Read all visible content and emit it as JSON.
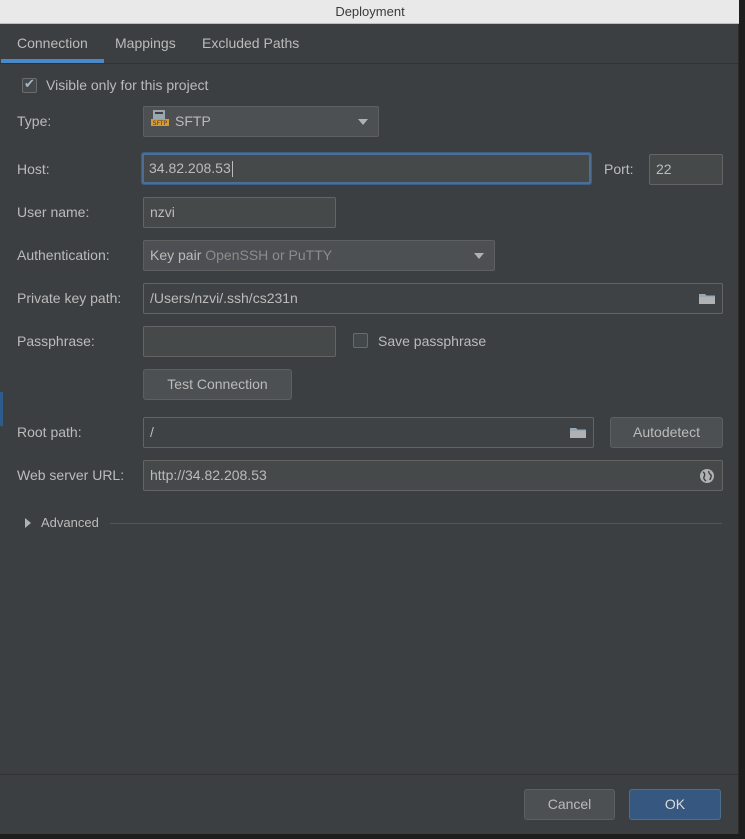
{
  "window": {
    "title": "Deployment"
  },
  "tabs": [
    {
      "label": "Connection",
      "active": true
    },
    {
      "label": "Mappings",
      "active": false
    },
    {
      "label": "Excluded Paths",
      "active": false
    }
  ],
  "form": {
    "visible_only_label": "Visible only for this project",
    "visible_only_checked": true,
    "type_label": "Type:",
    "type_value": "SFTP",
    "host_label": "Host:",
    "host_value": "34.82.208.53",
    "port_label": "Port:",
    "port_value": "22",
    "username_label": "User name:",
    "username_value": "nzvi",
    "auth_label": "Authentication:",
    "auth_value_main": "Key pair",
    "auth_value_hint": "OpenSSH or PuTTY",
    "private_key_label": "Private key path:",
    "private_key_value": "/Users/nzvi/.ssh/cs231n",
    "passphrase_label": "Passphrase:",
    "passphrase_value": "",
    "save_passphrase_label": "Save passphrase",
    "save_passphrase_checked": false,
    "test_connection_label": "Test Connection",
    "root_path_label": "Root path:",
    "root_path_value": "/",
    "autodetect_label": "Autodetect",
    "web_url_label": "Web server URL:",
    "web_url_value": "http://34.82.208.53",
    "advanced_label": "Advanced"
  },
  "footer": {
    "cancel_label": "Cancel",
    "ok_label": "OK"
  },
  "colors": {
    "accent": "#4a88c7",
    "background": "#3c3f41",
    "ok_button": "#365880"
  },
  "icons": [
    "checkbox-check-icon",
    "sftp-icon",
    "chevron-down-icon",
    "folder-icon",
    "globe-icon",
    "triangle-right-icon"
  ]
}
